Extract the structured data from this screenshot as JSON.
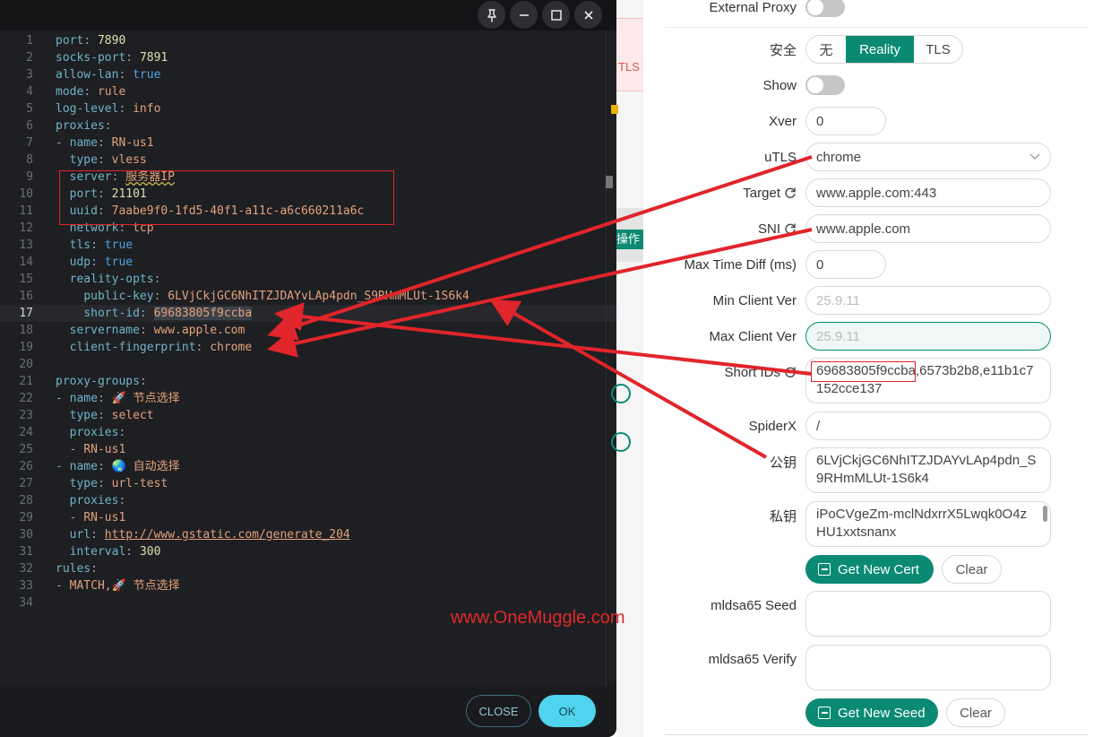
{
  "editor": {
    "lines": [
      {
        "n": "1",
        "html": "<span class='k'>port</span><span class='p'>: </span><span class='n'>7890</span>"
      },
      {
        "n": "2",
        "html": "<span class='k'>socks-port</span><span class='p'>: </span><span class='n'>7891</span>"
      },
      {
        "n": "3",
        "html": "<span class='k'>allow-lan</span><span class='p'>: </span><span class='b'>true</span>"
      },
      {
        "n": "4",
        "html": "<span class='k'>mode</span><span class='p'>: </span><span class='s'>rule</span>"
      },
      {
        "n": "5",
        "html": "<span class='k'>log-level</span><span class='p'>: </span><span class='s'>info</span>"
      },
      {
        "n": "6",
        "html": "<span class='k'>proxies</span><span class='p'>:</span>"
      },
      {
        "n": "7",
        "html": "<span class='p'>- </span><span class='k'>name</span><span class='p'>: </span><span class='s'>RN-us1</span>"
      },
      {
        "n": "8",
        "html": "  <span class='k'>type</span><span class='p'>: </span><span class='s'>vless</span>"
      },
      {
        "n": "9",
        "html": "  <span class='k'>server</span><span class='p'>: </span><span class='s squig'>服务器IP</span>"
      },
      {
        "n": "10",
        "html": "  <span class='k'>port</span><span class='p'>: </span><span class='n'>21101</span>"
      },
      {
        "n": "11",
        "html": "  <span class='k'>uuid</span><span class='p'>: </span><span class='s'>7aabe9f0-1fd5-40f1-a11c-a6c660211a6c</span>"
      },
      {
        "n": "12",
        "html": "  <span class='k'>network</span><span class='p'>: </span><span class='s'>tcp</span>"
      },
      {
        "n": "13",
        "html": "  <span class='k'>tls</span><span class='p'>: </span><span class='b'>true</span>"
      },
      {
        "n": "14",
        "html": "  <span class='k'>udp</span><span class='p'>: </span><span class='b'>true</span>"
      },
      {
        "n": "15",
        "html": "  <span class='k'>reality-opts</span><span class='p'>:</span>"
      },
      {
        "n": "16",
        "html": "    <span class='k'>public-key</span><span class='p'>: </span><span class='s'>6LVjCkjGC6NhITZJDAYvLAp4pdn_S9RHmMLUt-1S6k4</span>"
      },
      {
        "n": "17",
        "html": "    <span class='k'>short-id</span><span class='p'>: </span><span class='s hl'>69683805f9ccba</span>"
      },
      {
        "n": "18",
        "html": "  <span class='k'>servername</span><span class='p'>: </span><span class='s'>www.apple.com</span>"
      },
      {
        "n": "19",
        "html": "  <span class='k'>client-fingerprint</span><span class='p'>: </span><span class='s'>chrome</span>"
      },
      {
        "n": "20",
        "html": ""
      },
      {
        "n": "21",
        "html": "<span class='k'>proxy-groups</span><span class='p'>:</span>"
      },
      {
        "n": "22",
        "html": "<span class='p'>- </span><span class='k'>name</span><span class='p'>: </span><span class='s'>🚀 节点选择</span>"
      },
      {
        "n": "23",
        "html": "  <span class='k'>type</span><span class='p'>: </span><span class='s'>select</span>"
      },
      {
        "n": "24",
        "html": "  <span class='k'>proxies</span><span class='p'>:</span>"
      },
      {
        "n": "25",
        "html": "  <span class='p'>- </span><span class='s'>RN-us1</span>"
      },
      {
        "n": "26",
        "html": "<span class='p'>- </span><span class='k'>name</span><span class='p'>: </span><span class='s'>🌏 自动选择</span>"
      },
      {
        "n": "27",
        "html": "  <span class='k'>type</span><span class='p'>: </span><span class='s'>url-test</span>"
      },
      {
        "n": "28",
        "html": "  <span class='k'>proxies</span><span class='p'>:</span>"
      },
      {
        "n": "29",
        "html": "  <span class='p'>- </span><span class='s'>RN-us1</span>"
      },
      {
        "n": "30",
        "html": "  <span class='k'>url</span><span class='p'>: </span><span class='s u'>http://www.gstatic.com/generate_204</span>"
      },
      {
        "n": "31",
        "html": "  <span class='k'>interval</span><span class='p'>: </span><span class='n'>300</span>"
      },
      {
        "n": "32",
        "html": "<span class='k'>rules</span><span class='p'>:</span>"
      },
      {
        "n": "33",
        "html": "<span class='p'>- </span><span class='s'>MATCH,🚀 节点选择</span>"
      },
      {
        "n": "34",
        "html": ""
      }
    ],
    "active_line": "17",
    "close_label": "CLOSE",
    "ok_label": "OK",
    "watermark": "www.OneMuggle.com"
  },
  "background": {
    "tls_fragment": "TLS",
    "action_fragment": "操作"
  },
  "panel": {
    "external_proxy_label": "External Proxy",
    "security_label": "安全",
    "security_options": [
      "无",
      "Reality",
      "TLS"
    ],
    "security_selected": "Reality",
    "show_label": "Show",
    "xver_label": "Xver",
    "xver_value": "0",
    "utls_label": "uTLS",
    "utls_value": "chrome",
    "target_label": "Target",
    "target_value": "www.apple.com:443",
    "sni_label": "SNI",
    "sni_value": "www.apple.com",
    "max_time_diff_label": "Max Time Diff (ms)",
    "max_time_diff_value": "0",
    "min_client_label": "Min Client Ver",
    "min_client_placeholder": "25.9.11",
    "max_client_label": "Max Client Ver",
    "max_client_placeholder": "25.9.11",
    "short_ids_label": "Short IDs",
    "short_ids_value": "69683805f9ccba,6573b2b8,e11b1c7152cce137",
    "spiderx_label": "SpiderX",
    "spiderx_value": "/",
    "public_key_label": "公钥",
    "public_key_value": "6LVjCkjGC6NhITZJDAYvLAp4pdn_S9RHmMLUt-1S6k4",
    "private_key_label": "私钥",
    "private_key_value": "iPoCVgeZm-mclNdxrrX5Lwqk0O4zHU1xxtsnanx",
    "get_new_cert_label": "Get New Cert",
    "clear_label": "Clear",
    "mldsa_seed_label": "mldsa65 Seed",
    "mldsa_verify_label": "mldsa65 Verify",
    "get_new_seed_label": "Get New Seed",
    "clear2_label": "Clear"
  },
  "colors": {
    "accent": "#0a8a73",
    "annotation_red": "#e0252b",
    "ok_button": "#4fd3ee"
  }
}
